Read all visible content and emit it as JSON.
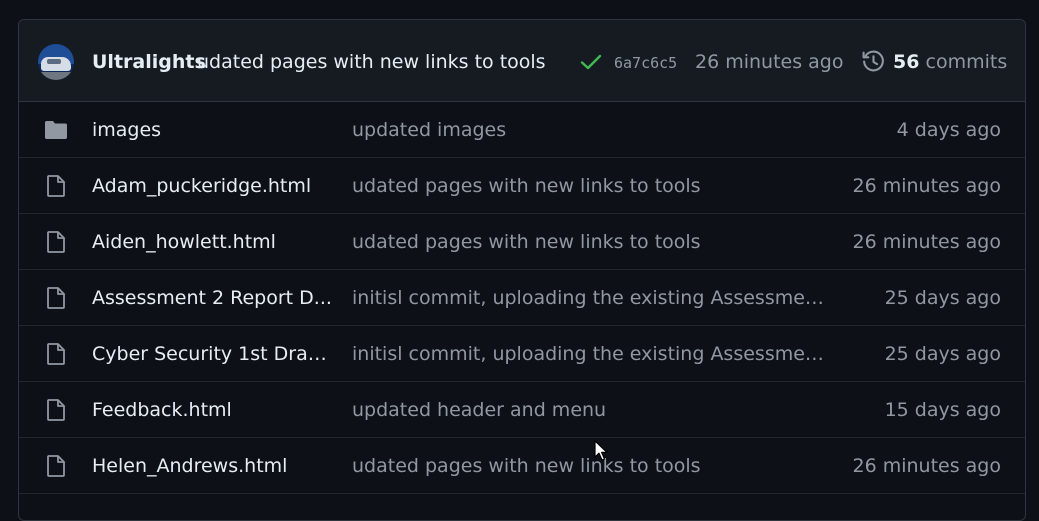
{
  "latest_commit": {
    "author": "Ultralights",
    "message": "udated pages with new links to tools",
    "sha": "6a7c6c5",
    "time": "26 minutes ago",
    "commit_count": "56",
    "commits_label": "commits",
    "status": "success",
    "status_color": "#3fb950"
  },
  "files": [
    {
      "type": "folder",
      "icon": "folder-icon",
      "name": "images",
      "message": "updated images",
      "age": "4 days ago"
    },
    {
      "type": "file",
      "icon": "file-icon",
      "name": "Adam_puckeridge.html",
      "message": "udated pages with new links to tools",
      "age": "26 minutes ago"
    },
    {
      "type": "file",
      "icon": "file-icon",
      "name": "Aiden_howlett.html",
      "message": "udated pages with new links to tools",
      "age": "26 minutes ago"
    },
    {
      "type": "file",
      "icon": "file-icon",
      "name": "Assessment 2 Report D...",
      "message": "initisl commit, uploading the existing Assessment...",
      "age": "25 days ago"
    },
    {
      "type": "file",
      "icon": "file-icon",
      "name": "Cyber Security 1st Draft...",
      "message": "initisl commit, uploading the existing Assessment...",
      "age": "25 days ago"
    },
    {
      "type": "file",
      "icon": "file-icon",
      "name": "Feedback.html",
      "message": "updated header and menu",
      "age": "15 days ago"
    },
    {
      "type": "file",
      "icon": "file-icon",
      "name": "Helen_Andrews.html",
      "message": "udated pages with new links to tools",
      "age": "26 minutes ago"
    }
  ]
}
